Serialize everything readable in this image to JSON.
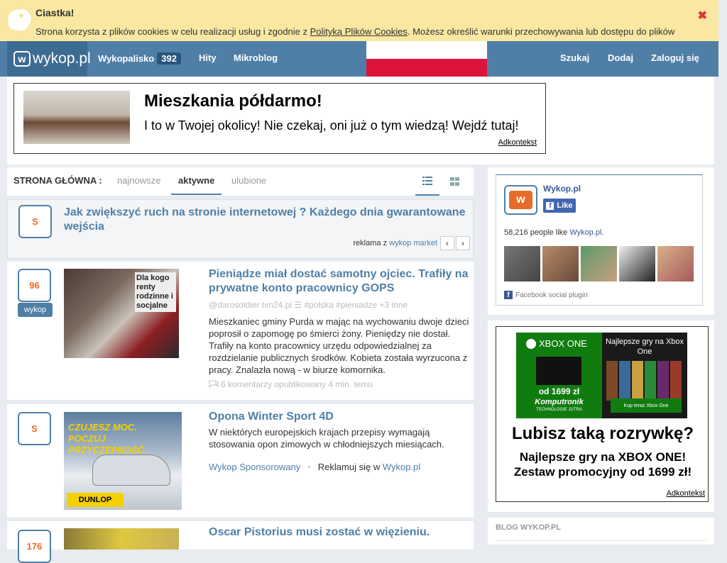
{
  "cookie": {
    "title": "Ciastka!",
    "text_before": "Strona korzysta z plików cookies w celu realizacji usług i zgodnie z ",
    "link": "Polityką Plików Cookies",
    "text_after": ". Możesz określić warunki przechowywania lub dostępu do plików",
    "close": "✖"
  },
  "nav": {
    "logo": "wykop.pl",
    "logo_letter": "w",
    "items": [
      {
        "label": "Wykopalisko",
        "badge": "392"
      },
      {
        "label": "Hity"
      },
      {
        "label": "Mikroblog"
      }
    ],
    "right": [
      {
        "label": "Szukaj"
      },
      {
        "label": "Dodaj"
      },
      {
        "label": "Zaloguj się"
      }
    ]
  },
  "top_ad": {
    "title": "Mieszkania półdarmo!",
    "subtitle": "I to w Twojej okolicy! Nie czekaj, oni już o tym wiedzą! Wejdź tutaj!",
    "link": "Adkontekst"
  },
  "tabs": {
    "label": "STRONA GŁÓWNA :",
    "items": [
      "najnowsze",
      "aktywne",
      "ulubione"
    ]
  },
  "sponsored": {
    "vote": "S",
    "title": "Jak zwiększyć ruch na stronie internetowej ? Każdego dnia gwarantowane wejścia",
    "foot_prefix": "reklama z ",
    "foot_link": "wykop market",
    "prev": "‹",
    "next": "›"
  },
  "posts": [
    {
      "votes": "96",
      "button": "wykop",
      "title": "Pieniądze miał dostać samotny ojciec. Trafiły na prywatne konto pracownicy GOPS",
      "meta": "@darosoldier   tvn24.pl   ☰   #polska   #pieniadze   +3 inne",
      "body": "Mieszkaniec gminy Purda w mając na wychowaniu dwoje dzieci poprosił o zapomogę po śmierci żony. Pieniędzy nie dostał. Trafiły na konto pracownicy urzędu odpowiedzialnej za rozdzielanie publicznych środków. Kobieta została wyrzucona z pracy. Znalazła nową - w biurze komornika.",
      "foot": "6 komentarzy      opublikowany 4 min. temu",
      "thumb_text": "Dla kogo renty rodzinne i socjalne"
    },
    {
      "votes": "S",
      "title": "Opona Winter Sport 4D",
      "body": "W niektórych europejskich krajach przepisy wymagają stosowania opon zimowych w chłodniejszych miesiącach.",
      "foot_link1": "Wykop Sponsorowany",
      "foot_text": "Reklamuj się w ",
      "foot_link2": "Wykop.pl",
      "thumb_text": "CZUJESZ MOC. POCZUJ PRZYCZEPNOŚĆ.",
      "thumb_brand": "DUNLOP"
    },
    {
      "votes": "176",
      "title": "Oscar Pistorius musi zostać w więzieniu."
    }
  ],
  "facebook": {
    "name": "Wykop.pl",
    "like": "Like",
    "count_prefix": "58,216 people like ",
    "count_link": "Wykop.pl",
    "count_suffix": ".",
    "plugin": "Facebook social plugin"
  },
  "xbox_ad": {
    "brand": "XBOX ONE",
    "price": "od 1699 zł",
    "komputronik": "Komputronik",
    "tech": "TECHNOLOGIE JUTRA",
    "right_title": "Najlepsze gry na Xbox One",
    "cta": "Kup teraz Xbox One",
    "headline": "Lubisz taką rozrywkę?",
    "sub1": "Najlepsze gry na XBOX ONE!",
    "sub2": "Zestaw promocyjny od 1699 zł!",
    "link": "Adkontekst"
  },
  "blog": {
    "title": "BLOG WYKOP.PL"
  },
  "colors": {
    "accent": "#4f7fa7",
    "orange": "#e86b2a",
    "cookie_bg": "#f9e7a2"
  }
}
